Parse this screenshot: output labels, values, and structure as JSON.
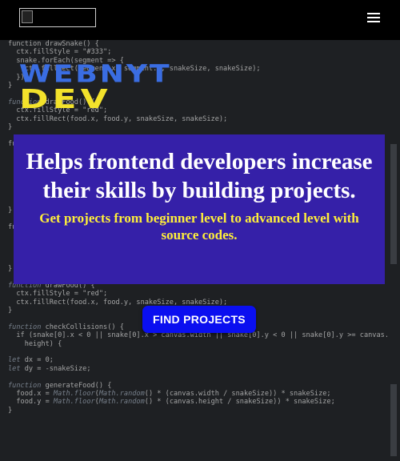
{
  "nav": {
    "logo_icon": "broken-image-icon",
    "menu_icon": "hamburger-menu-icon"
  },
  "brand": {
    "line1": "WEBNYT",
    "line2": "DEV",
    "colors": {
      "line1": "#3a6de2",
      "line2": "#f3e22b"
    }
  },
  "hero": {
    "heading": "Helps frontend developers increase their skills by building projects.",
    "subheading": "Get projects from beginner level to advanced level with source codes.",
    "cta_label": "FIND PROJECTS",
    "colors": {
      "box": "#3520a8",
      "subheading": "#ffef3a",
      "cta": "#0a0ff0"
    }
  }
}
